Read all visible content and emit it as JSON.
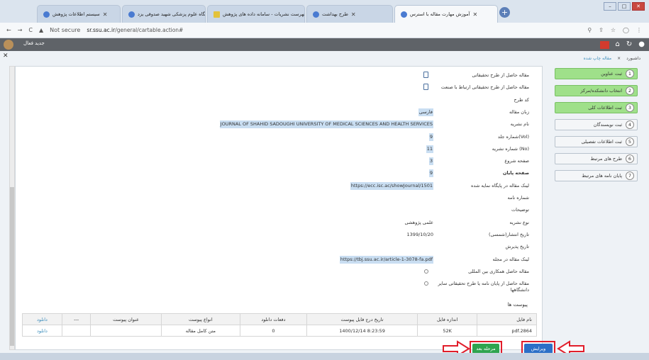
{
  "browser": {
    "tabs": [
      {
        "label": "سیستم اطلاعات پژوهش",
        "active": false
      },
      {
        "label": "دانشگاه علوم پزشکی شهید صدوقی یزد",
        "active": false
      },
      {
        "label": "فهرست نشریات - سامانه داده های پژوهش",
        "active": false
      },
      {
        "label": "طرح بهداشت",
        "active": false
      },
      {
        "label": "آموزش مهارت مقاله با استرس",
        "active": true
      }
    ],
    "new_tab": "+",
    "window_buttons": [
      "–",
      "□",
      "✕"
    ],
    "nav_back": "←",
    "nav_forward": "→",
    "nav_reload": "C",
    "not_secure": "Not secure",
    "url_host": "sr.ssu.ac.ir",
    "url_path": "/general/cartable.action#",
    "right_icons": [
      "⚲",
      "⇪",
      "☆",
      "◯",
      "⋮"
    ]
  },
  "app": {
    "title": "جدید فعال",
    "icons": [
      "⌂",
      "↻",
      "●"
    ]
  },
  "close_glyph": "✕",
  "breadcrumb": {
    "home": "داشبورد",
    "sep": "×",
    "current": "مقاله چاپ شده"
  },
  "steps": [
    {
      "num": "1",
      "label": "ثبت عناوین",
      "done": true
    },
    {
      "num": "2",
      "label": "انتخاب دانشکده/مرکز",
      "done": true
    },
    {
      "num": "3",
      "label": "ثبت اطلاعات کلی",
      "done": true
    },
    {
      "num": "4",
      "label": "ثبت نویسندگان",
      "done": false
    },
    {
      "num": "5",
      "label": "ثبت اطلاعات تفصیلی",
      "done": false
    },
    {
      "num": "6",
      "label": "طرح های مرتبط",
      "done": false
    },
    {
      "num": "7",
      "label": "پایان نامه های مرتبط",
      "done": false
    }
  ],
  "form_rows": [
    {
      "label": "مقاله حاصل از طرح تحقیقاتی",
      "type": "icon"
    },
    {
      "label": "مقاله حاصل از طرح تحقیقاتی ارتباط با صنعت",
      "type": "icon"
    },
    {
      "label": "کد طرح",
      "type": "text",
      "value": ""
    },
    {
      "label": "زبان مقاله",
      "type": "text",
      "value": "فارسی",
      "hl": true
    },
    {
      "label": "نام نشریه",
      "type": "text",
      "value": "JOURNAL OF SHAHID SADOUGHI UNIVERSITY OF MEDICAL SCIENCES AND HEALTH SERVICES",
      "hl": true
    },
    {
      "label": "شماره جلد(Vol)",
      "type": "text",
      "value": "9",
      "hl": true
    },
    {
      "label": "شماره نشریه (No)",
      "type": "text",
      "value": "11",
      "hl": true
    },
    {
      "label": "صفحه شروع",
      "type": "text",
      "value": "3",
      "hl": true
    },
    {
      "label": "صفحه پایان",
      "type": "text",
      "value": "9",
      "hl": true,
      "bold": true
    },
    {
      "label": "لینک مقاله در پایگاه نمایه شده",
      "type": "text",
      "value": "https://ecc.isc.ac/showJournal/1501",
      "hl": true
    },
    {
      "label": "شماره نامه",
      "type": "text",
      "value": ""
    },
    {
      "label": "توضیحات",
      "type": "text",
      "value": ""
    },
    {
      "label": "نوع نشریه",
      "type": "text",
      "value": "علمی پژوهشی"
    },
    {
      "label": "تاریخ انتشار(شمسی)",
      "type": "text",
      "value": "1399/10/20"
    },
    {
      "label": "تاریخ پذیرش",
      "type": "text",
      "value": ""
    },
    {
      "label": "لینک مقاله در مجله",
      "type": "text",
      "value": "https://tbj.ssu.ac.ir/article-1-3078-fa.pdf",
      "hl": true
    },
    {
      "label": "مقاله حاصل همکاری بین المللی",
      "type": "radio"
    },
    {
      "label": "مقاله حاصل از پایان نامه یا طرح تحقیقاتی سایر دانشگاهها",
      "type": "radio",
      "tall": true
    }
  ],
  "attachments": {
    "title": "پیوست ها",
    "headers": [
      "نام فایل",
      "اندازه فایل",
      "تاریخ درج فایل پیوست",
      "دفعات دانلود",
      "انواع پیوست",
      "عنوان پیوست",
      "---",
      "دانلود"
    ],
    "rows": [
      [
        "pdf.2864",
        "52K",
        "8:23:59  1400/12/14",
        "0",
        "متن کامل مقاله",
        "",
        "",
        "دانلود"
      ]
    ]
  },
  "buttons": {
    "next": "مرحله بعد",
    "edit": "ویرایش"
  },
  "colors": {
    "done_step": "#9fe08a",
    "link": "#3c8dbc",
    "next_btn": "#2ea44f",
    "edit_btn": "#2b6fc7",
    "annotation": "#e11d2a"
  }
}
